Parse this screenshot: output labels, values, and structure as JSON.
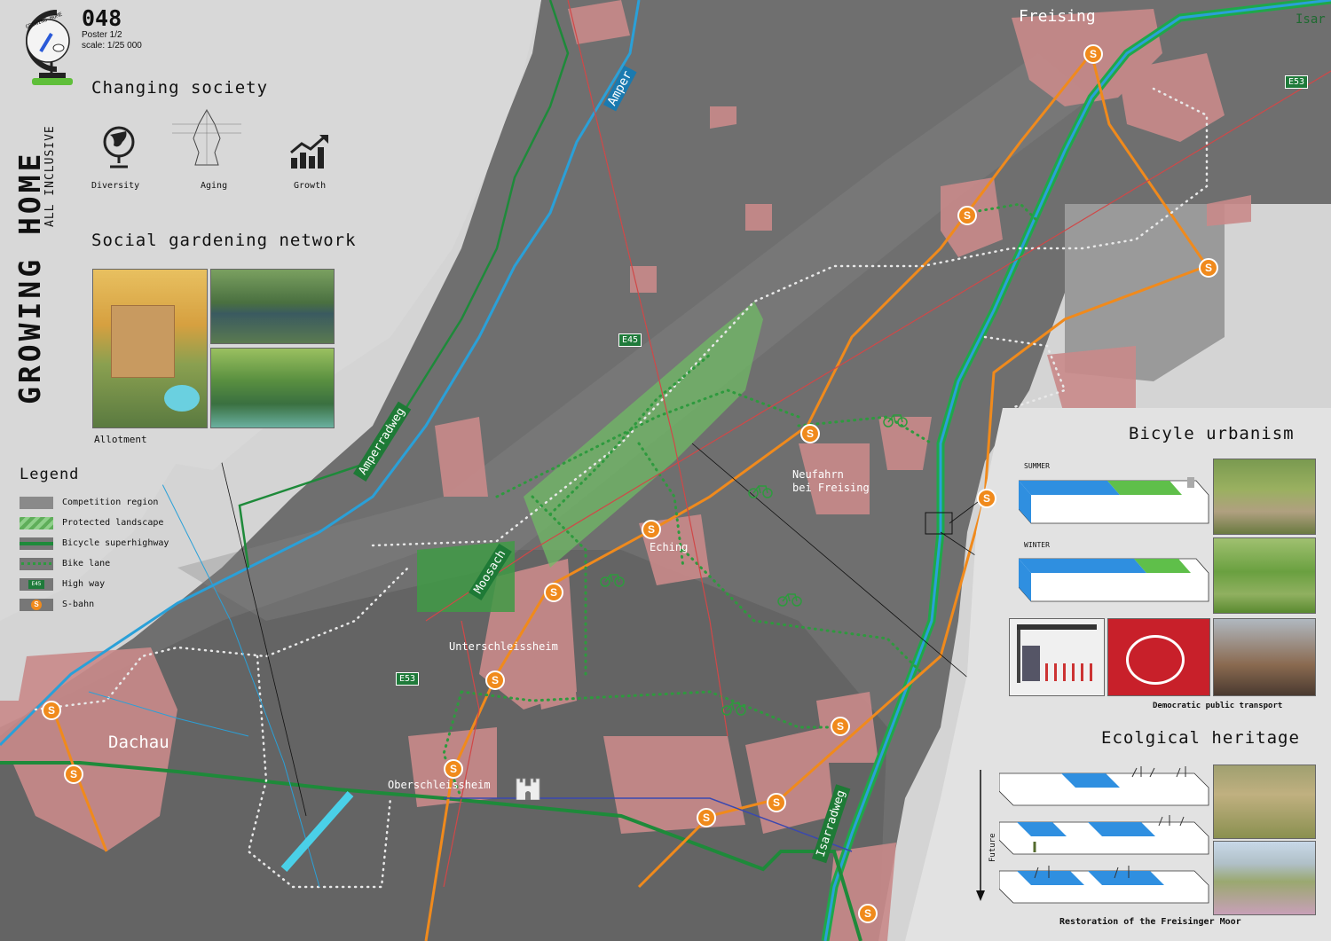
{
  "poster": {
    "number": "048",
    "poster_label": "Poster 1/2",
    "scale_label": "scale: 1/25 000",
    "title": "GROWING HOME",
    "subtitle": "ALL INCLUSIVE",
    "logo_text": "GROWING HOME"
  },
  "changing_society": {
    "heading": "Changing society",
    "items": [
      {
        "label": "Diversity",
        "icon": "globe-icon"
      },
      {
        "label": "Aging",
        "icon": "population-pyramid-icon"
      },
      {
        "label": "Growth",
        "icon": "growth-chart-icon"
      }
    ]
  },
  "social_gardening": {
    "heading": "Social gardening network",
    "caption": "Allotment"
  },
  "legend": {
    "heading": "Legend",
    "items": [
      {
        "label": "Competition region",
        "color": "#8a8a8a"
      },
      {
        "label": "Protected landscape",
        "color": "#5fae5a"
      },
      {
        "label": "Bicycle superhighway",
        "color": "#1e8a3a"
      },
      {
        "label": "Bike lane",
        "color": "#2e9a3e"
      },
      {
        "label": "High way",
        "color": "#1f7a3a",
        "badge": "E45"
      },
      {
        "label": "S-bahn",
        "color": "#f08a1c",
        "badge": "S"
      }
    ]
  },
  "map_labels": {
    "freising": "Freising",
    "isar": "Isar",
    "amper": "Amper",
    "amperradweg": "Amperradweg",
    "moosach": "Moosach",
    "eching": "Eching",
    "neufahrn_1": "Neufahrn",
    "neufahrn_2": "bei Freising",
    "unterschleissheim": "Unterschleissheim",
    "dachau": "Dachau",
    "oberschleissheim": "Oberschleissheim",
    "isarradweg": "Isarradweg",
    "e45": "E45",
    "e53_a": "E53",
    "e53_b": "E53",
    "sbahn_letter": "S"
  },
  "bicycle_urbanism": {
    "heading": "Bicyle urbanism",
    "summer": "SUMMER",
    "winter": "WINTER",
    "caption": "Democratic public transport"
  },
  "ecological_heritage": {
    "heading": "Ecolgical heritage",
    "future": "Future",
    "caption": "Restoration of the Freisinger Moor"
  },
  "colors": {
    "settlement": "#c98a8a",
    "river": "#2aa0d8",
    "bike_superhighway": "#1e8a3a",
    "sbahn": "#f08a1c",
    "protected": "#5fae5a"
  }
}
